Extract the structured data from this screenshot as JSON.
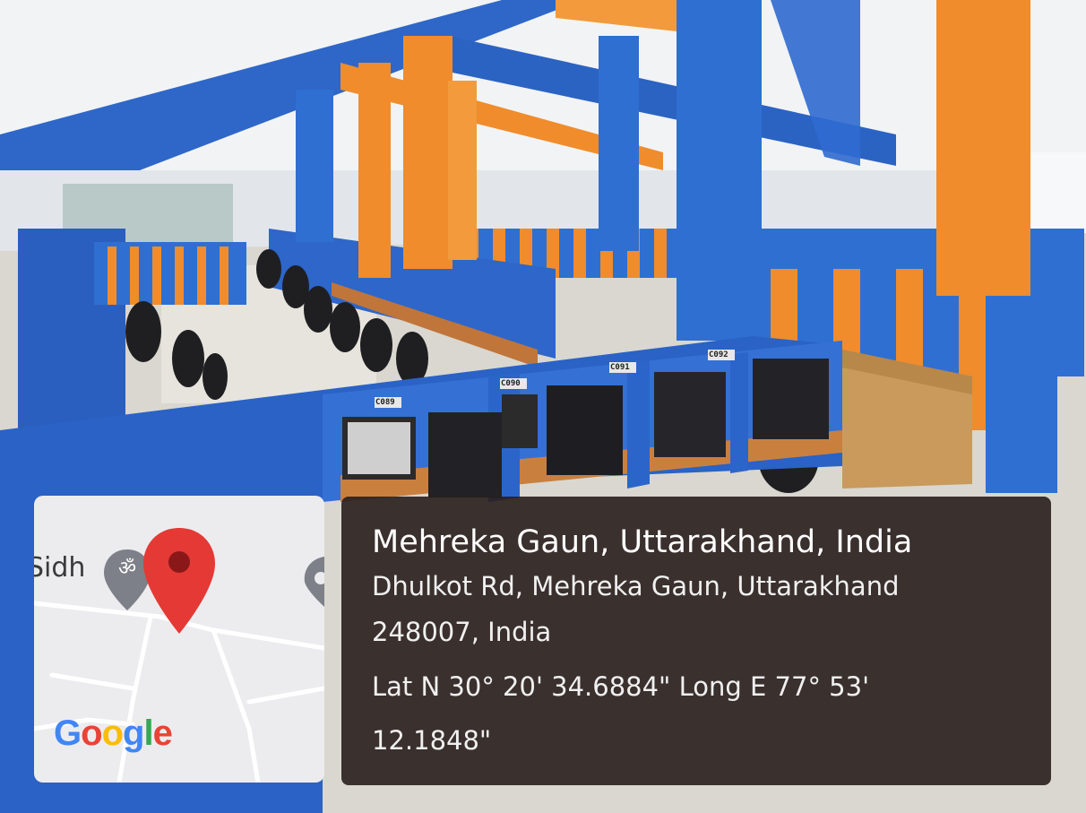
{
  "photo": {
    "subject": "computer lab with blue and orange cubicles",
    "workstation_labels": [
      "C089",
      "C090",
      "C091",
      "C092"
    ]
  },
  "map": {
    "street_fragment": "Sidh",
    "poi_glyph": "ॐ",
    "pin_icon": "location-pin-icon",
    "logo_letters": [
      {
        "ch": "G",
        "color": "#4285f4"
      },
      {
        "ch": "o",
        "color": "#ea4335"
      },
      {
        "ch": "o",
        "color": "#fbbc05"
      },
      {
        "ch": "g",
        "color": "#4285f4"
      },
      {
        "ch": "l",
        "color": "#34a853"
      },
      {
        "ch": "e",
        "color": "#ea4335"
      }
    ]
  },
  "location": {
    "title": "Mehreka Gaun, Uttarakhand, India",
    "address_line1": "Dhulkot Rd, Mehreka Gaun, Uttarakhand",
    "address_line2": "248007, India",
    "coords_line1": "Lat N 30° 20' 34.6884\" Long E 77° 53'",
    "coords_line2": "12.1848\""
  },
  "colors": {
    "pillar_orange": "#f08c2c",
    "pillar_blue": "#2f6fd1",
    "pin_red": "#e53935",
    "overlay_dark": "#281e1c"
  }
}
